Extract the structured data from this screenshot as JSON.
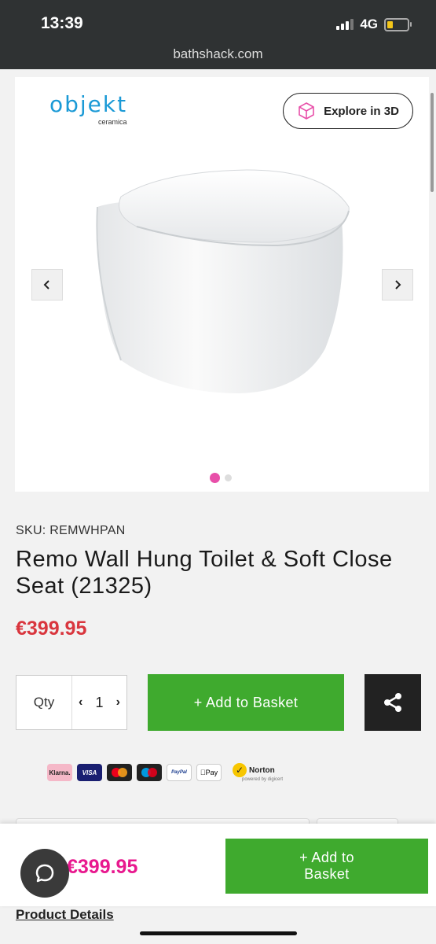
{
  "status_bar": {
    "time": "13:39",
    "network": "4G"
  },
  "browser": {
    "url": "bathshack.com"
  },
  "gallery": {
    "brand_logo": {
      "name": "objekt",
      "sub": "ceramica"
    },
    "explore_3d_label": "Explore in 3D",
    "prev_icon": "chevron-left-icon",
    "next_icon": "chevron-right-icon",
    "slide_count": 2,
    "active_slide": 1,
    "colors": {
      "active_dot": "#e84fa9"
    }
  },
  "product": {
    "sku": "SKU: REMWHPAN",
    "title": "Remo Wall Hung Toilet & Soft Close Seat (21325)",
    "price": "€399.95"
  },
  "purchase": {
    "qty_label": "Qty",
    "qty_value": "1",
    "add_to_basket_label": "+ Add to Basket",
    "colors": {
      "add_button": "#3faa2e",
      "price": "#d9363e"
    }
  },
  "payments": {
    "methods": [
      "Klarna.",
      "VISA",
      "Mastercard",
      "Maestro",
      "PayPal",
      "Pay"
    ],
    "trust_badge": "Norton",
    "trust_sub": "powered by digicert"
  },
  "sticky_bar": {
    "price": "€399.95",
    "add_to_basket_label": "+ Add to Basket",
    "colors": {
      "price": "#e8188e"
    }
  },
  "links": {
    "product_details": "Product Details"
  }
}
